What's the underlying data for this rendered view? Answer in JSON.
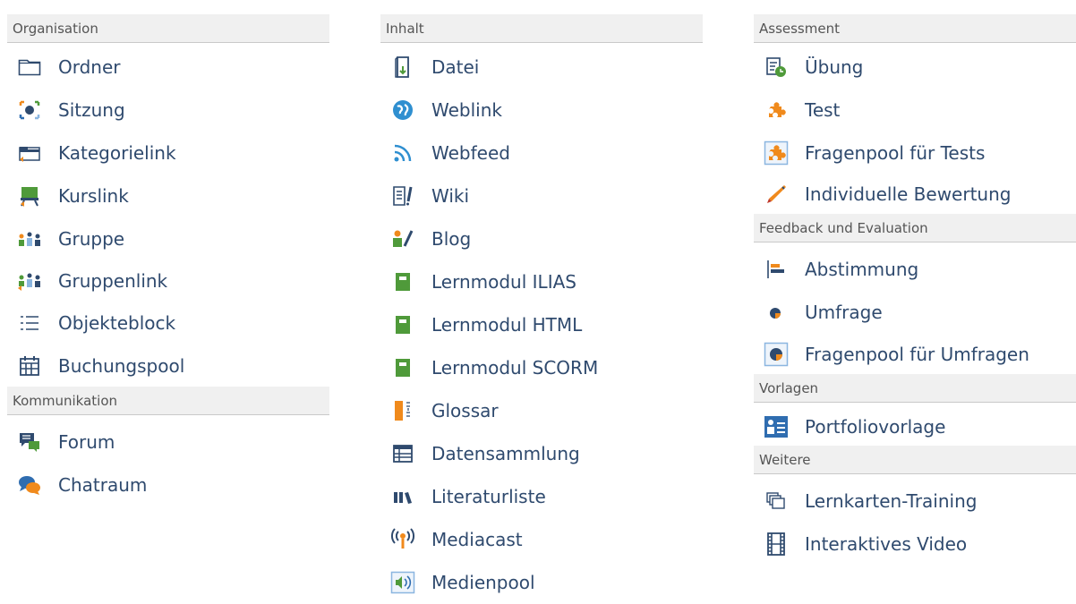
{
  "col1": {
    "sections": [
      {
        "title": "Organisation",
        "items": [
          {
            "label": "Ordner",
            "icon": "folder-icon"
          },
          {
            "label": "Sitzung",
            "icon": "session-icon"
          },
          {
            "label": "Kategorielink",
            "icon": "category-link-icon"
          },
          {
            "label": "Kurslink",
            "icon": "course-link-icon"
          },
          {
            "label": "Gruppe",
            "icon": "group-icon"
          },
          {
            "label": "Gruppenlink",
            "icon": "group-link-icon"
          },
          {
            "label": "Objekteblock",
            "icon": "item-group-icon"
          },
          {
            "label": "Buchungspool",
            "icon": "booking-pool-icon"
          }
        ]
      },
      {
        "title": "Kommunikation",
        "items": [
          {
            "label": "Forum",
            "icon": "forum-icon"
          },
          {
            "label": "Chatraum",
            "icon": "chatroom-icon"
          }
        ]
      }
    ]
  },
  "col2": {
    "sections": [
      {
        "title": "Inhalt",
        "items": [
          {
            "label": "Datei",
            "icon": "file-icon"
          },
          {
            "label": "Weblink",
            "icon": "weblink-icon"
          },
          {
            "label": "Webfeed",
            "icon": "webfeed-icon"
          },
          {
            "label": "Wiki",
            "icon": "wiki-icon"
          },
          {
            "label": "Blog",
            "icon": "blog-icon"
          },
          {
            "label": "Lernmodul ILIAS",
            "icon": "learning-module-icon"
          },
          {
            "label": "Lernmodul HTML",
            "icon": "learning-module-icon"
          },
          {
            "label": "Lernmodul SCORM",
            "icon": "learning-module-icon"
          },
          {
            "label": "Glossar",
            "icon": "glossary-icon"
          },
          {
            "label": "Datensammlung",
            "icon": "data-collection-icon"
          },
          {
            "label": "Literaturliste",
            "icon": "bibliography-icon"
          },
          {
            "label": "Mediacast",
            "icon": "mediacast-icon"
          },
          {
            "label": "Medienpool",
            "icon": "media-pool-icon"
          }
        ]
      }
    ]
  },
  "col3": {
    "sections": [
      {
        "title": "Assessment",
        "items": [
          {
            "label": "Übung",
            "icon": "exercise-icon"
          },
          {
            "label": "Test",
            "icon": "test-icon"
          },
          {
            "label": "Fragenpool für Tests",
            "icon": "question-pool-test-icon"
          },
          {
            "label": "Individuelle Bewertung",
            "icon": "individual-assessment-icon"
          }
        ]
      },
      {
        "title": "Feedback und Evaluation",
        "items": [
          {
            "label": "Abstimmung",
            "icon": "poll-icon"
          },
          {
            "label": "Umfrage",
            "icon": "survey-icon"
          },
          {
            "label": "Fragenpool für Umfragen",
            "icon": "question-pool-survey-icon"
          }
        ]
      },
      {
        "title": "Vorlagen",
        "items": [
          {
            "label": "Portfoliovorlage",
            "icon": "portfolio-template-icon"
          }
        ]
      },
      {
        "title": "Weitere",
        "items": [
          {
            "label": "Lernkarten-Training",
            "icon": "flashcards-icon"
          },
          {
            "label": "Interaktives Video",
            "icon": "interactive-video-icon"
          }
        ]
      }
    ]
  },
  "colors": {
    "label_text": "#2f4a6e",
    "header_bg": "#f0f0f0",
    "header_text": "#555555",
    "accent_orange": "#f08a1c",
    "accent_green": "#4f9a3a",
    "accent_blue": "#2f6db0"
  }
}
